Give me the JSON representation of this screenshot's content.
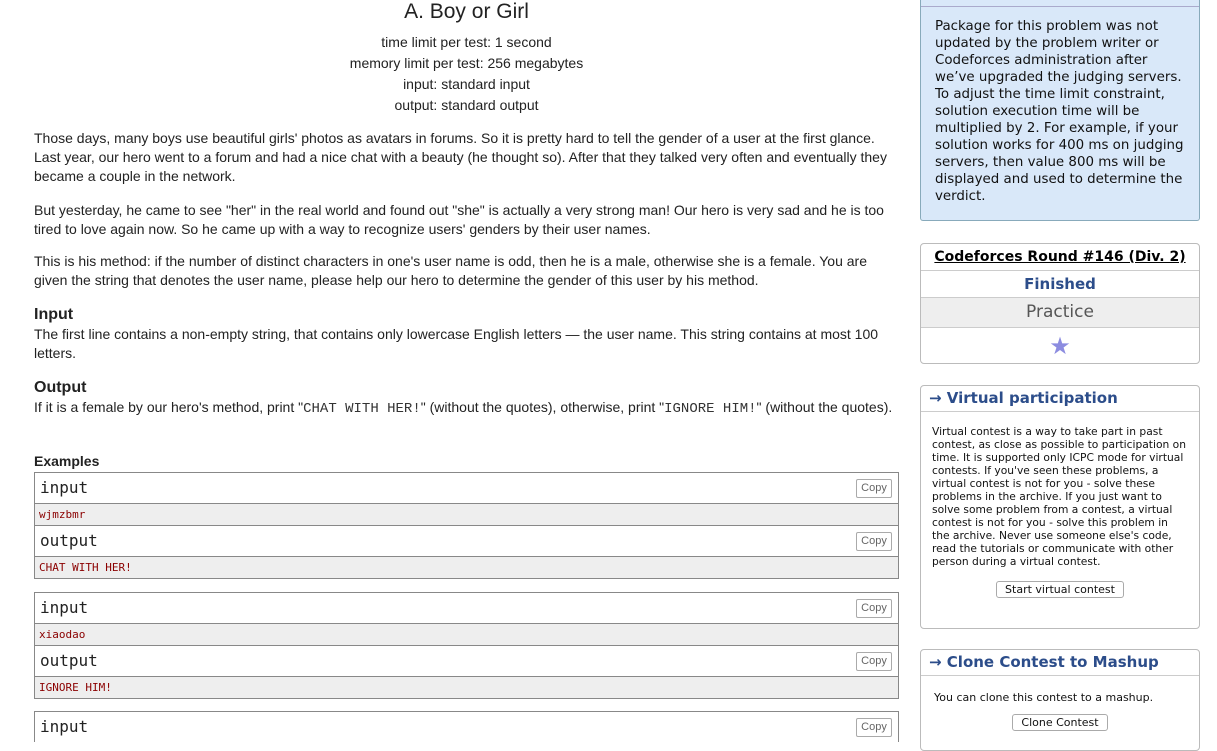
{
  "problem": {
    "title": "A. Boy or Girl",
    "time_limit": "time limit per test: 1 second",
    "memory_limit": "memory limit per test: 256 megabytes",
    "input": "input: standard input",
    "output": "output: standard output",
    "legend_1": "Those days, many boys use beautiful girls' photos as avatars in forums. So it is pretty hard to tell the gender of a user at the first glance. Last year, our hero went to a forum and had a nice chat with a beauty (he thought so). After that they talked very often and eventually they became a couple in the network.",
    "legend_2": "But yesterday, he came to see \"her\" in the real world and found out \"she\" is actually a very strong man! Our hero is very sad and he is too tired to love again now. So he came up with a way to recognize users' genders by their user names.",
    "legend_3": "This is his method: if the number of distinct characters in one's user name is odd, then he is a male, otherwise she is a female. You are given the string that denotes the user name, please help our hero to determine the gender of this user by his method.",
    "input_title": "Input",
    "input_text": "The first line contains a non-empty string, that contains only lowercase English letters — the user name. This string contains at most 100 letters.",
    "output_title": "Output",
    "output_pre": "If it is a female by our hero's method, print \"",
    "output_code1": "CHAT WITH HER!",
    "output_mid": "\" (without the quotes), otherwise, print \"",
    "output_code2": "IGNORE HIM!",
    "output_post": "\" (without the quotes).",
    "examples_title": "Examples",
    "input_label": "input",
    "output_label": "output",
    "copy_label": "Copy",
    "examples": [
      {
        "input": "wjmzbmr",
        "output": "CHAT WITH HER!"
      },
      {
        "input": "xiaodao",
        "output": "IGNORE HIM!"
      }
    ]
  },
  "sidebar": {
    "notice": "Package for this problem was not updated by the problem writer or Codeforces administration after we’ve upgraded the judging servers. To adjust the time limit constraint, solution execution time will be multiplied by 2. For example, if your solution works for 400 ms on judging servers, then value 800 ms will be displayed and used to determine the verdict.",
    "round_name": "Codeforces Round #146 (Div. 2)",
    "round_status": "Finished",
    "round_mode": "Practice",
    "virtual_title": "→ Virtual participation",
    "virtual_text": "Virtual contest is a way to take part in past contest, as close as possible to participation on time. It is supported only ICPC mode for virtual contests. If you've seen these problems, a virtual contest is not for you - solve these problems in the archive. If you just want to solve some problem from a contest, a virtual contest is not for you - solve this problem in the archive. Never use someone else's code, read the tutorials or communicate with other person during a virtual contest.",
    "virtual_button": "Start virtual contest",
    "clone_title": "→ Clone Contest to Mashup",
    "clone_text": "You can clone this contest to a mashup.",
    "clone_button": "Clone Contest"
  }
}
